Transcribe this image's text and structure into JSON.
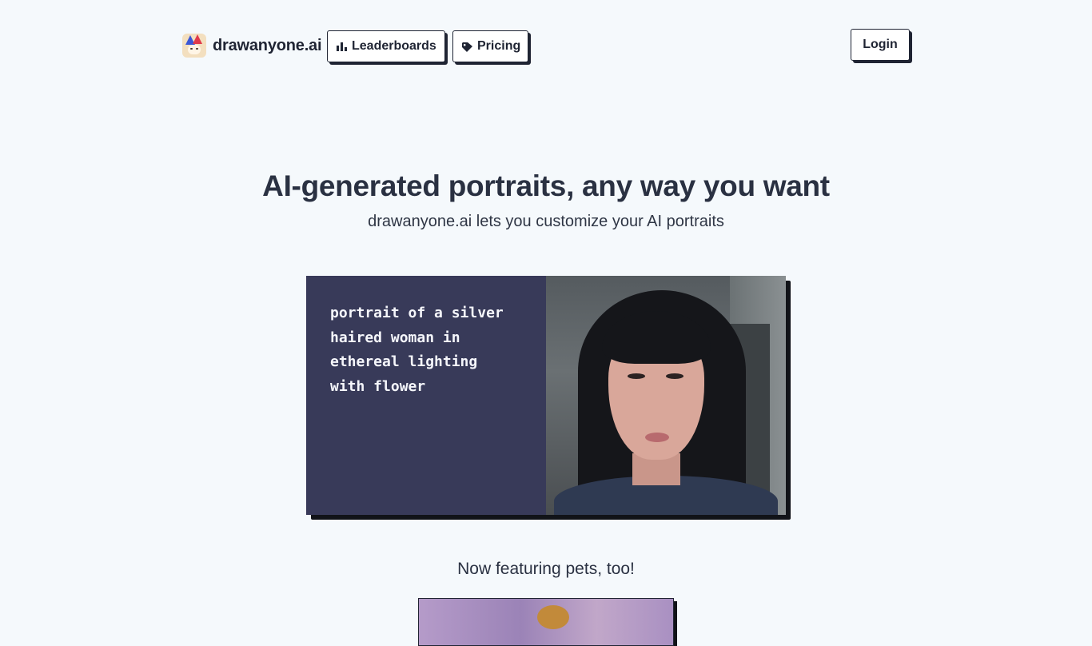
{
  "brand": {
    "name": "drawanyone.ai",
    "logo_icon": "jester-hat-logo-icon"
  },
  "nav": {
    "leaderboards_label": "Leaderboards",
    "leaderboards_icon": "bar-chart-icon",
    "pricing_label": "Pricing",
    "pricing_icon": "tag-icon",
    "login_label": "Login"
  },
  "hero": {
    "title": "AI-generated portraits, any way you want",
    "subtitle": "drawanyone.ai lets you customize your AI portraits"
  },
  "demo": {
    "prompt": "portrait of a silver\nhaired woman in\nethereal lighting\nwith flower",
    "panel_color": "#383a59"
  },
  "pets": {
    "title": "Now featuring pets, too!"
  },
  "colors": {
    "background": "#f5f9fc",
    "text": "#2a3142",
    "border": "#1f2433"
  }
}
